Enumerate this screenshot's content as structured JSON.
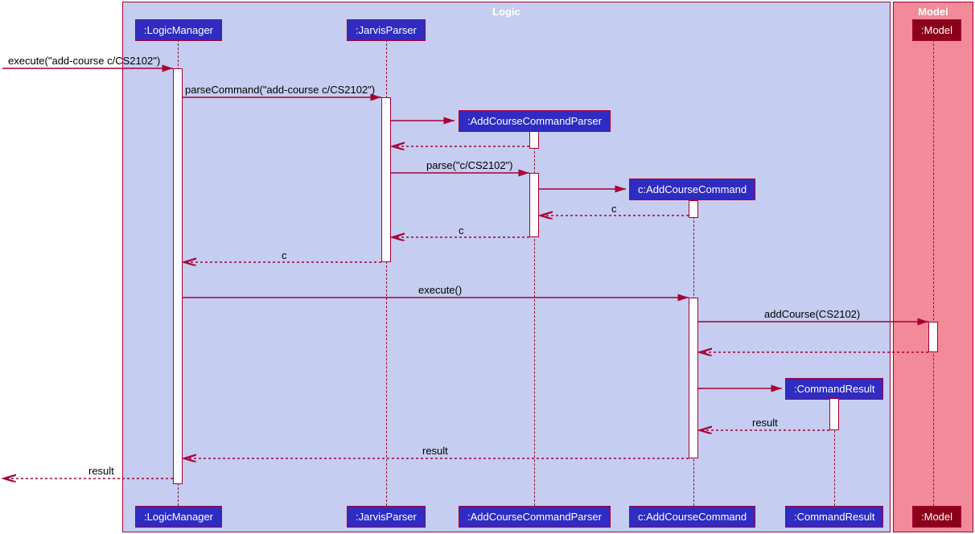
{
  "frames": {
    "logic": "Logic",
    "model": "Model"
  },
  "participants": {
    "logicManager": ":LogicManager",
    "jarvisParser": ":JarvisParser",
    "addCourseCommandParser": ":AddCourseCommandParser",
    "addCourseCommand": "c:AddCourseCommand",
    "commandResult": ":CommandResult",
    "model": ":Model"
  },
  "messages": {
    "execute1": "execute(\"add-course c/CS2102\")",
    "parseCommand": "parseCommand(\"add-course c/CS2102\")",
    "parse": "parse(\"c/CS2102\")",
    "c": "c",
    "execute2": "execute()",
    "addCourse": "addCourse(CS2102)",
    "result": "result"
  }
}
